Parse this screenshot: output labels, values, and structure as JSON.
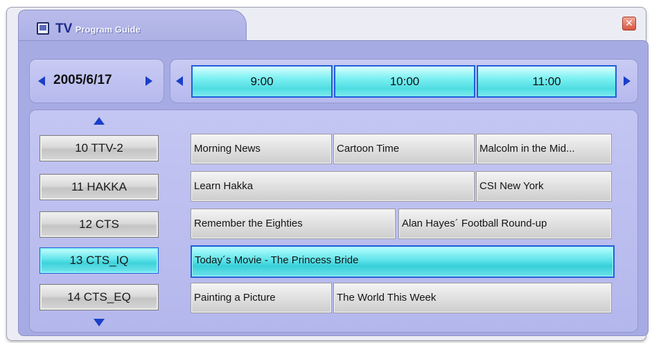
{
  "window": {
    "title_main": "TV",
    "title_sub": "Program Guide",
    "close_glyph": "✕"
  },
  "date": {
    "label": "2005/6/17"
  },
  "timeline": {
    "slots": [
      "9:00",
      "10:00",
      "11:00"
    ]
  },
  "channels": [
    {
      "label": "10 TTV-2",
      "selected": false
    },
    {
      "label": "11 HAKKA",
      "selected": false
    },
    {
      "label": "12 CTS",
      "selected": false
    },
    {
      "label": "13 CTS_IQ",
      "selected": true
    },
    {
      "label": "14 CTS_EQ",
      "selected": false
    }
  ],
  "programs": [
    [
      {
        "title": "Morning News"
      },
      {
        "title": "Cartoon Time"
      },
      {
        "title": "Malcolm in the Mid..."
      }
    ],
    [
      {
        "title": "Learn Hakka"
      },
      {
        "title": "CSI New York"
      }
    ],
    [
      {
        "title": "Remember the Eighties"
      },
      {
        "title": "Alan Hayes´ Football Round-up"
      }
    ],
    [
      {
        "title": "Today´s Movie - The Princess Bride",
        "selected": true
      }
    ],
    [
      {
        "title": "Painting a Picture"
      },
      {
        "title": "The World This Week"
      }
    ]
  ],
  "colors": {
    "accent_blue": "#1a3fc8",
    "selection_cyan": "#4fdde2",
    "panel_lavender": "#a7abe3"
  },
  "icons": {
    "app": "tv-guide-icon",
    "close": "close-icon",
    "prev_day": "arrow-left-icon",
    "next_day": "arrow-right-icon",
    "prev_time": "arrow-left-icon",
    "next_time": "arrow-right-icon",
    "channels_up": "arrow-up-icon",
    "channels_down": "arrow-down-icon"
  }
}
